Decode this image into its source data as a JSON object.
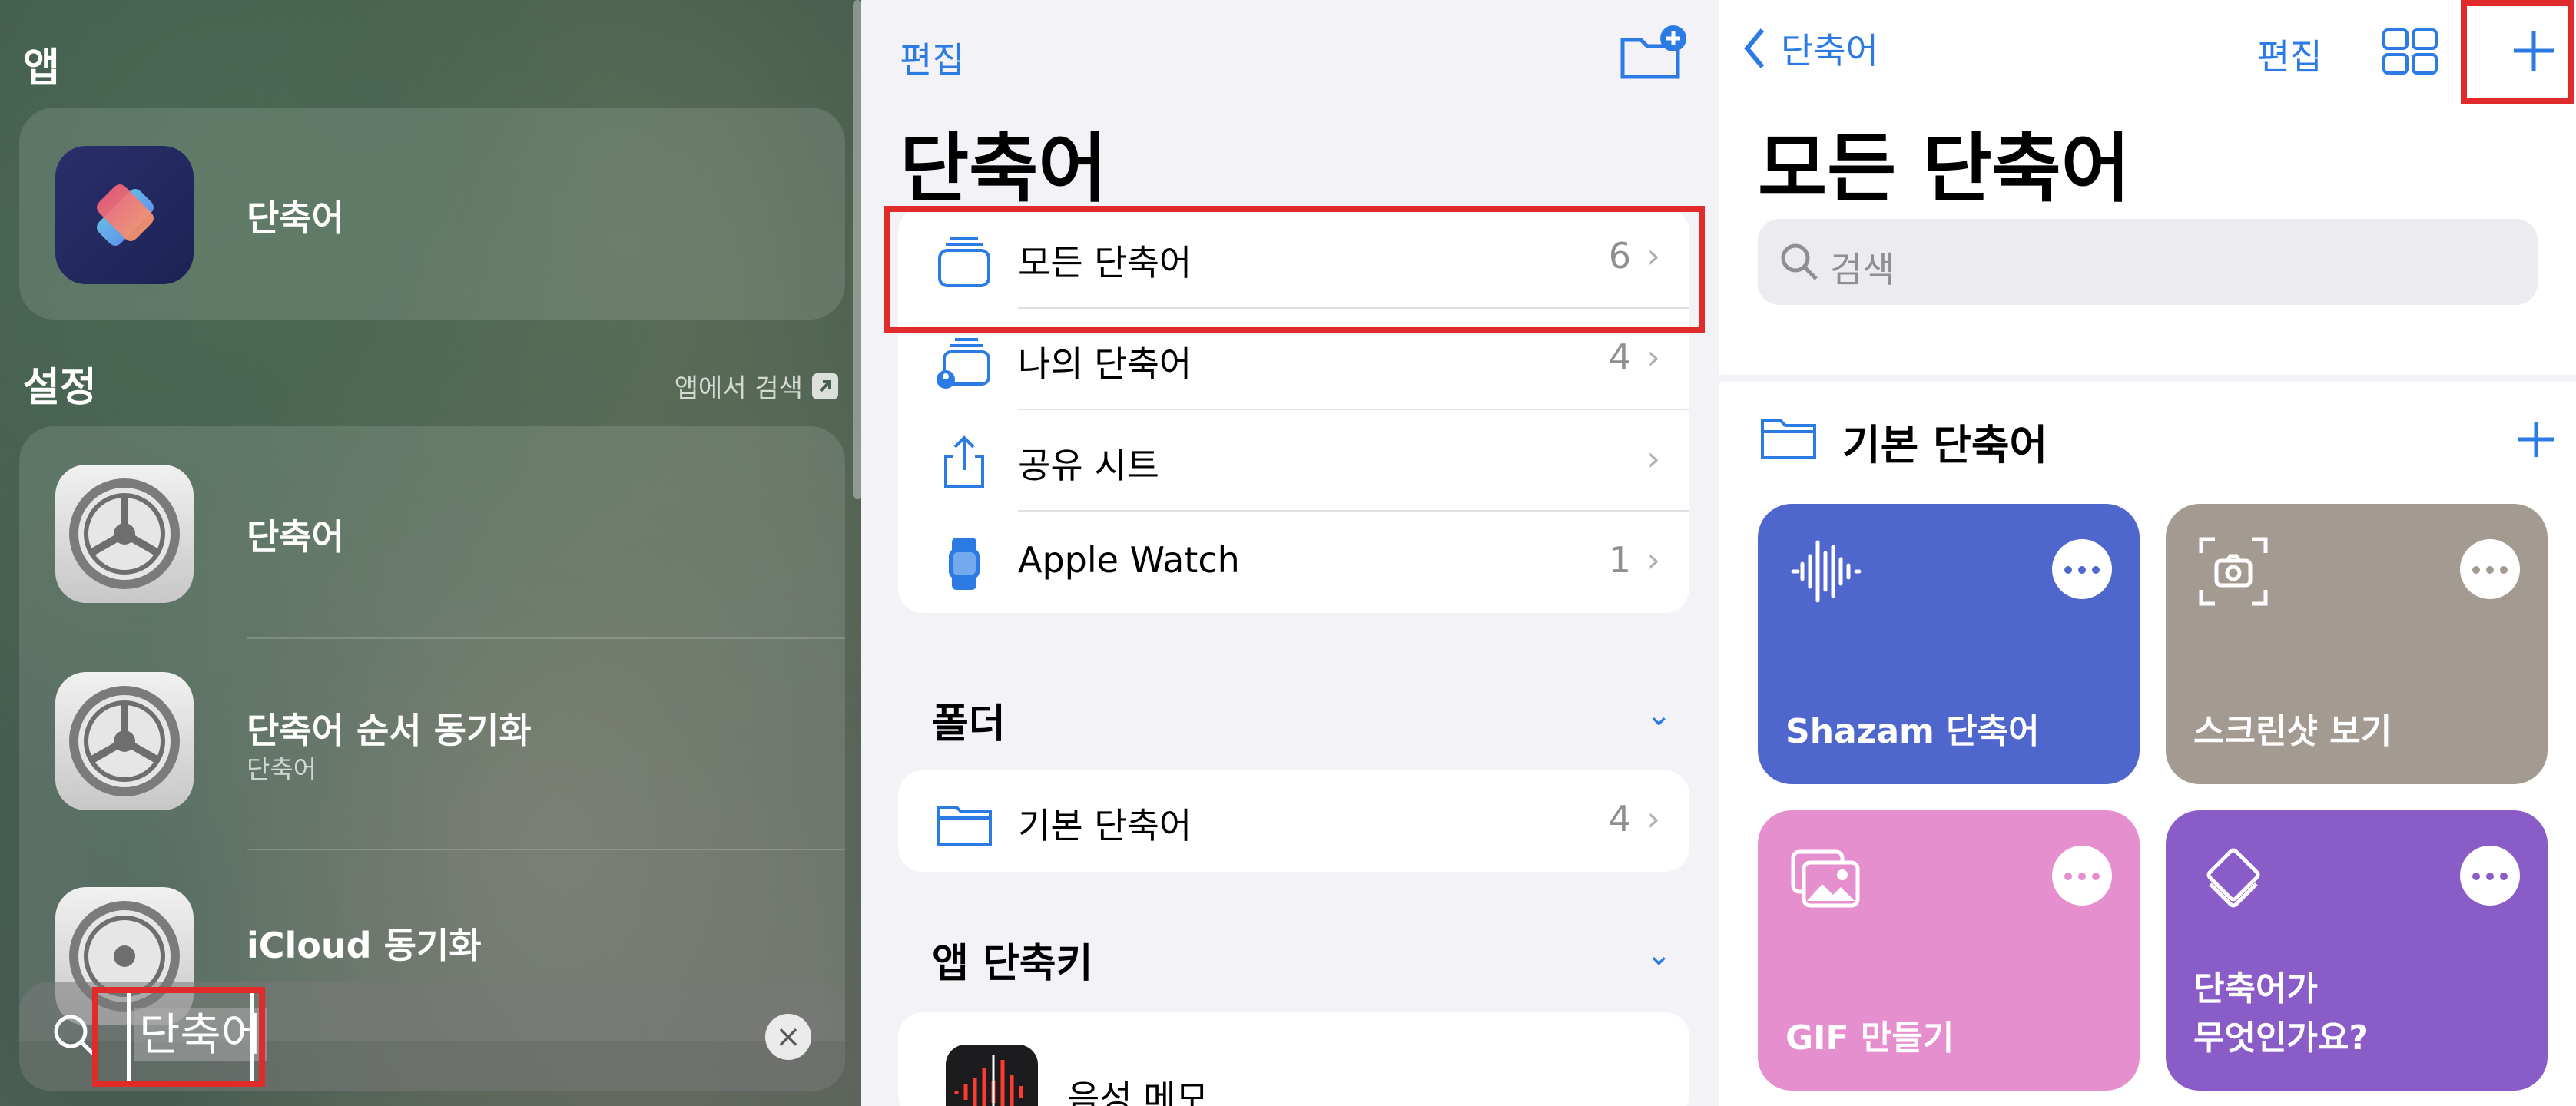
{
  "spotlight": {
    "apps_header": "앱",
    "app_result": {
      "name": "단축어"
    },
    "settings_header": "설정",
    "search_in_app": "앱에서 검색",
    "settings_results": [
      {
        "name": "단축어",
        "sub": ""
      },
      {
        "name": "단축어 순서 동기화",
        "sub": "단축어"
      },
      {
        "name": "iCloud 동기화",
        "sub": ""
      }
    ],
    "search_query": "단축어"
  },
  "sidebar": {
    "edit": "편집",
    "title": "단축어",
    "items": [
      {
        "label": "모든 단축어",
        "count": "6"
      },
      {
        "label": "나의 단축어",
        "count": "4"
      },
      {
        "label": "공유 시트",
        "count": ""
      },
      {
        "label": "Apple Watch",
        "count": "1"
      }
    ],
    "folders_header": "폴더",
    "folders": [
      {
        "label": "기본 단축어",
        "count": "4"
      }
    ],
    "app_shortcuts_header": "앱 단축키",
    "app_shortcuts": [
      {
        "label": "음성 메모"
      }
    ]
  },
  "library": {
    "back_label": "단축어",
    "edit": "편집",
    "title": "모든 단축어",
    "search_placeholder": "검색",
    "folder_name": "기본 단축어",
    "tiles": [
      {
        "name": "Shazam 단축어",
        "icon": "waveform-icon",
        "color": "#4f66cc"
      },
      {
        "name": "스크린샷 보기",
        "icon": "screenshot-camera-icon",
        "color": "#a39a92"
      },
      {
        "name": "GIF 만들기",
        "icon": "photos-icon",
        "color": "#e58fcf"
      },
      {
        "name": "단축어가\n무엇인가요?",
        "icon": "layers-icon",
        "color": "#8a5cc8"
      }
    ],
    "accent_color": "#2c7be5",
    "highlight_color": "#e12a2a"
  }
}
